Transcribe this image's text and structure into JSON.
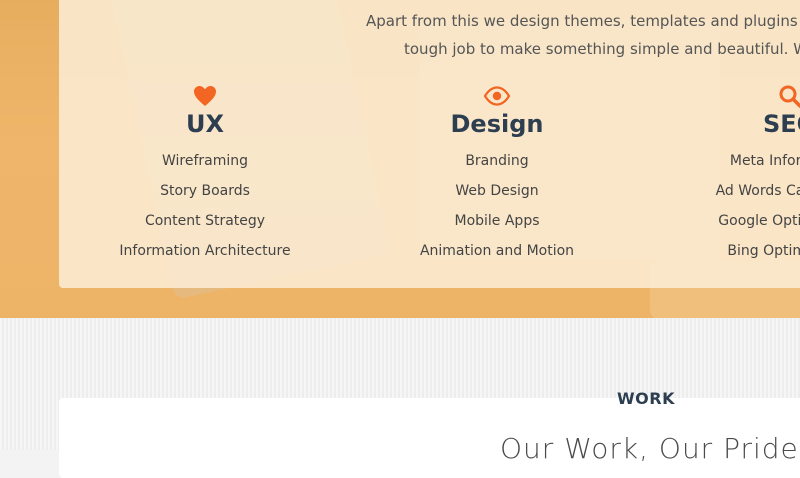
{
  "intro": {
    "line1": "Apart from this we design themes, templates and plugins which",
    "line2": "tough job to make something simple and beautiful. We love"
  },
  "services": [
    {
      "title": "UX",
      "icon": "heart-icon",
      "items": [
        "Wireframing",
        "Story Boards",
        "Content Strategy",
        "Information Architecture"
      ]
    },
    {
      "title": "Design",
      "icon": "eye-icon",
      "items": [
        "Branding",
        "Web Design",
        "Mobile Apps",
        "Animation and Motion"
      ]
    },
    {
      "title": "SEO",
      "icon": "search-icon",
      "items": [
        "Meta Information",
        "Ad Words Campaigns",
        "Google Optimization",
        "Bing Optimization"
      ]
    }
  ],
  "work": {
    "label": "WORK",
    "title": "Our Work, Our Pride"
  },
  "colors": {
    "accent": "#f26522",
    "heading": "#2c3e50",
    "hero_bg": "#edb468"
  }
}
